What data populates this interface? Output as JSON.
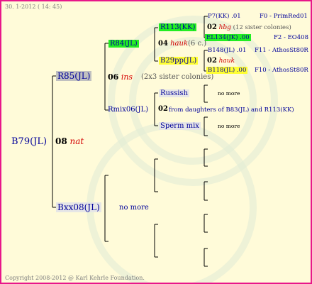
{
  "header": {
    "date": "30. 1-2012 ( 14: 45)"
  },
  "footer": {
    "copyright": "Copyright 2008-2012 @ Karl Kehrle Foundation."
  },
  "pedigree": {
    "queen": "B79(JL)",
    "queen_year": "08",
    "queen_trait": "nat",
    "mother": "R85(JL)",
    "mother_year": "06",
    "mother_trait": "ins",
    "mother_note": "(2x3 sister colonies)",
    "father": "Bxx08(JL)",
    "father_note": "no more",
    "mm": "R84(JL)",
    "mm_year": "04",
    "mm_trait": "hauk",
    "mm_note": "(6 c.)",
    "mf": "Rmix06(JL)",
    "mf_year": "02",
    "mf_note": "from daughters of B83(JL) and R113(KK)",
    "mf_sub1": "Russish",
    "mf_sub1_note": "no more",
    "mf_sub2": "Sperm mix",
    "mf_sub2_note": "no more",
    "mmm": "R113(KK)",
    "mmm_year": "02",
    "mmm_trait": "hbg",
    "mmm_note": "(12 sister colonies)",
    "mmmm": "P7(KK) .01",
    "mmmm_f": "F0 - PrimRed01",
    "mmmf": "EL134(JK) .00",
    "mmmf_f": "F2 - EO408",
    "mmf": "B29pp(JL)",
    "mmf_year": "02",
    "mmf_trait": "hauk",
    "mmfm": "B148(JL) .01",
    "mmfm_f": "F11 - AthosSt80R",
    "mmff": "B118(JL) .00",
    "mmff_f": "F10 - AthosSt80R"
  }
}
